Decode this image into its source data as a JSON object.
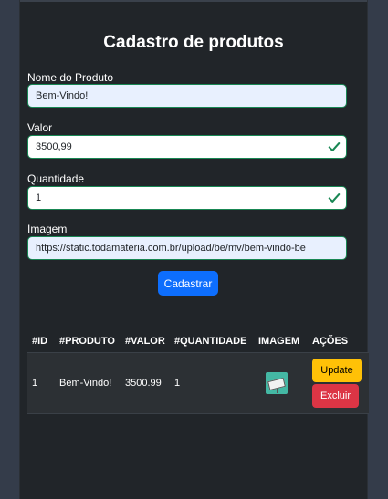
{
  "form": {
    "title": "Cadastro de produtos",
    "fields": [
      {
        "label": "Nome do Produto",
        "value": "Bem-Vindo!"
      },
      {
        "label": "Valor",
        "value": "3500,99"
      },
      {
        "label": "Quantidade",
        "value": "1"
      },
      {
        "label": "Imagem",
        "value": "https://static.todamateria.com.br/upload/be/mv/bem-vindo-be"
      }
    ],
    "submit_label": "Cadastrar"
  },
  "table": {
    "headers": [
      "#ID",
      "#PRODUTO",
      "#VALOR",
      "#QUANTIDADE",
      "IMAGEM",
      "AÇÕES"
    ],
    "rows": [
      {
        "id": "1",
        "produto": "Bem-Vindo!",
        "valor": "3500.99",
        "quantidade": "1",
        "image_icon": "welcome-sign-image",
        "update_label": "Update",
        "delete_label": "Excluir"
      }
    ]
  },
  "colors": {
    "valid_border": "#198754",
    "primary": "#0d6efd",
    "warning": "#ffc107",
    "danger": "#dc3545",
    "panel_bg": "#212529",
    "page_bg": "#343c4a"
  }
}
